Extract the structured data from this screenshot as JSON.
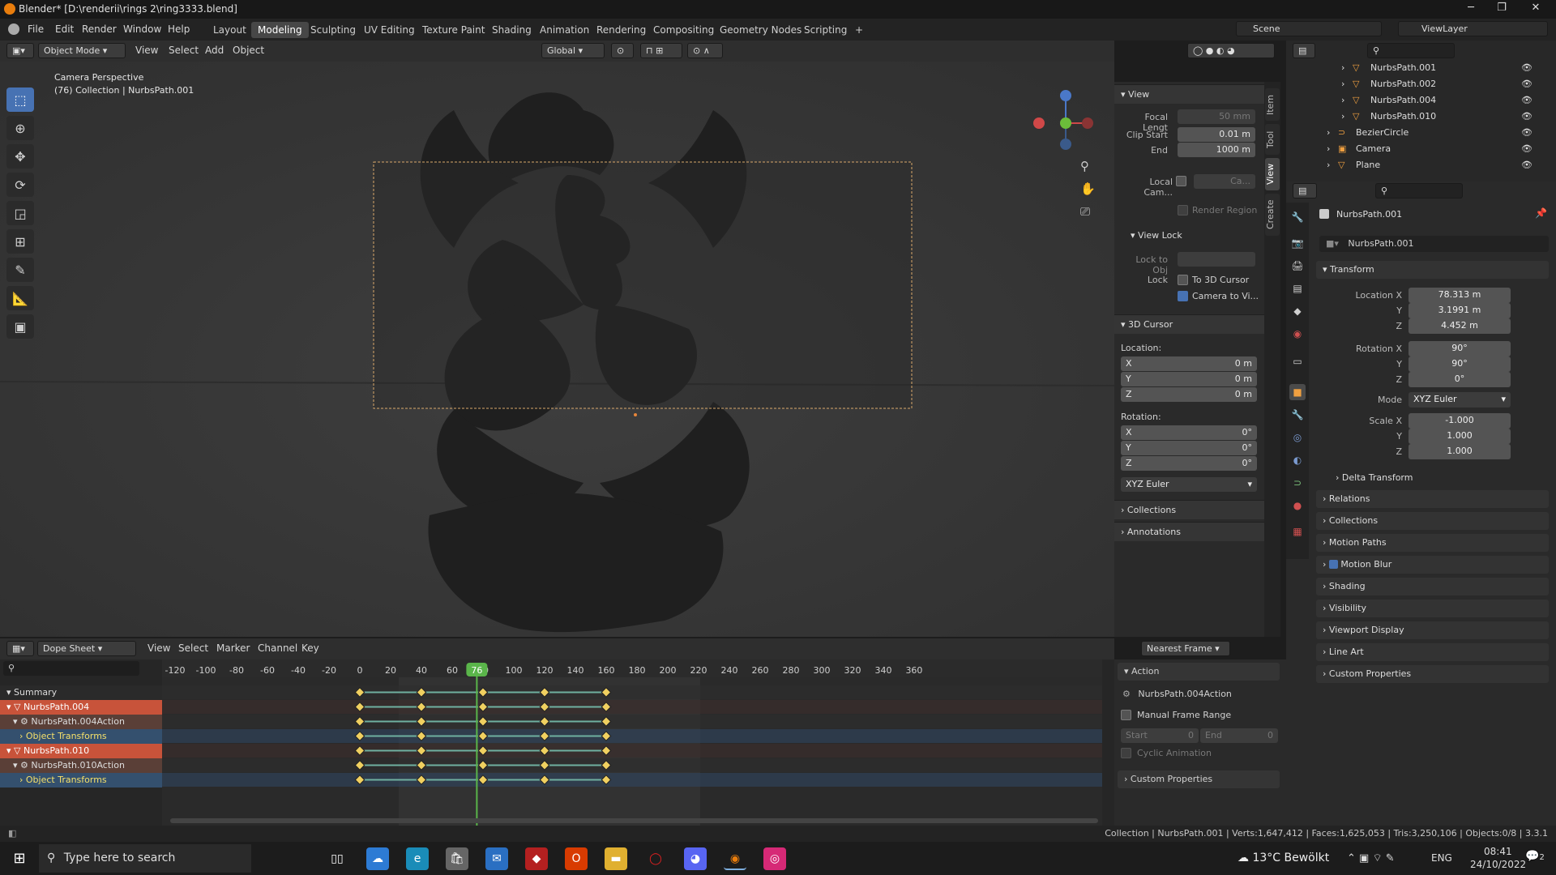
{
  "window": {
    "title": "Blender* [D:\\renderii\\rings 2\\ring3333.blend]"
  },
  "menu": [
    "File",
    "Edit",
    "Render",
    "Window",
    "Help"
  ],
  "workspaces": [
    "Layout",
    "Modeling",
    "Sculpting",
    "UV Editing",
    "Texture Paint",
    "Shading",
    "Animation",
    "Rendering",
    "Compositing",
    "Geometry Nodes",
    "Scripting"
  ],
  "active_workspace": "Modeling",
  "scene": {
    "name": "Scene",
    "view_layer": "ViewLayer"
  },
  "viewport_header": {
    "mode": "Object Mode",
    "menus": [
      "View",
      "Select",
      "Add",
      "Object"
    ],
    "orientation": "Global",
    "options": "Options"
  },
  "overlay_text": {
    "line1": "Camera Perspective",
    "line2": "(76) Collection | NurbsPath.001"
  },
  "npanel": {
    "tabs": [
      "Item",
      "Tool",
      "View",
      "Create"
    ],
    "view": {
      "title": "View",
      "focal_label": "Focal Lengt",
      "focal_value": "50 mm",
      "clip_start_label": "Clip Start",
      "clip_start": "0.01 m",
      "clip_end_label": "End",
      "clip_end": "1000 m",
      "local_cam_label": "Local Cam...",
      "local_cam_value": "Ca...",
      "render_region": "Render Region"
    },
    "view_lock": {
      "title": "View Lock",
      "lock_obj_label": "Lock to Obj",
      "lock_label": "Lock",
      "to_cursor": "To 3D Cursor",
      "camera_to_view": "Camera to Vi..."
    },
    "cursor": {
      "title": "3D Cursor",
      "location_label": "Location:",
      "rotation_label": "Rotation:",
      "x": "0 m",
      "y": "0 m",
      "z": "0 m",
      "rx": "0°",
      "ry": "0°",
      "rz": "0°",
      "mode": "XYZ Euler"
    },
    "collections": "Collections",
    "annotations": "Annotations"
  },
  "outliner": [
    {
      "name": "NurbsPath.001",
      "indent": 1
    },
    {
      "name": "NurbsPath.002",
      "indent": 1
    },
    {
      "name": "NurbsPath.004",
      "indent": 1
    },
    {
      "name": "NurbsPath.010",
      "indent": 1
    },
    {
      "name": "BezierCircle",
      "indent": 0
    },
    {
      "name": "Camera",
      "indent": 0
    },
    {
      "name": "Plane",
      "indent": 0
    }
  ],
  "properties": {
    "object_name": "NurbsPath.001",
    "data_name": "NurbsPath.001",
    "transform_title": "Transform",
    "location_label": "Location X",
    "loc_x": "78.313 m",
    "loc_y": "3.1991 m",
    "loc_z": "4.452 m",
    "rotation_label": "Rotation X",
    "rot_x": "90°",
    "rot_y": "90°",
    "rot_z": "0°",
    "mode_label": "Mode",
    "mode": "XYZ Euler",
    "scale_label": "Scale X",
    "scale_x": "-1.000",
    "scale_y": "1.000",
    "scale_z": "1.000",
    "y_label": "Y",
    "z_label": "Z",
    "sections": [
      "Delta Transform",
      "Relations",
      "Collections",
      "Motion Paths",
      "Motion Blur",
      "Shading",
      "Visibility",
      "Viewport Display",
      "Line Art",
      "Custom Properties"
    ]
  },
  "dopesheet": {
    "editor": "Dope Sheet",
    "menus": [
      "View",
      "Select",
      "Marker",
      "Channel",
      "Key"
    ],
    "snap": "Nearest Frame",
    "current_frame": "76",
    "ruler": [
      "-120",
      "-100",
      "-80",
      "-60",
      "-40",
      "-20",
      "0",
      "20",
      "40",
      "60",
      "80",
      "100",
      "120",
      "140",
      "160",
      "180",
      "200",
      "220",
      "240",
      "260",
      "280",
      "300",
      "320",
      "340",
      "360"
    ],
    "channels": [
      {
        "name": "Summary",
        "kind": "summary"
      },
      {
        "name": "NurbsPath.004",
        "kind": "object"
      },
      {
        "name": "NurbsPath.004Action",
        "kind": "action"
      },
      {
        "name": "Object Transforms",
        "kind": "group"
      },
      {
        "name": "NurbsPath.010",
        "kind": "object"
      },
      {
        "name": "NurbsPath.010Action",
        "kind": "action"
      },
      {
        "name": "Object Transforms",
        "kind": "group"
      }
    ],
    "keyframes": [
      0,
      40,
      80,
      120,
      160
    ]
  },
  "action_panel": {
    "title": "Action",
    "action_name": "NurbsPath.004Action",
    "manual_range": "Manual Frame Range",
    "start_label": "Start",
    "start": "0",
    "end_label": "End",
    "end": "0",
    "cyclic": "Cyclic Animation",
    "custom": "Custom Properties"
  },
  "status": {
    "text": "Collection | NurbsPath.001 | Verts:1,647,412 | Faces:1,625,053 | Tris:3,250,106 | Objects:0/8 | 3.3.1"
  },
  "taskbar": {
    "search": "Type here to search",
    "weather": "13°C Bewölkt",
    "lang": "ENG",
    "time": "08:41",
    "date": "24/10/2022",
    "notify": "2"
  },
  "colors": {
    "accent": "#4772b3",
    "frame": "#5ab54a",
    "keyframe": "#f0d060",
    "object_row": "#c8533a"
  }
}
